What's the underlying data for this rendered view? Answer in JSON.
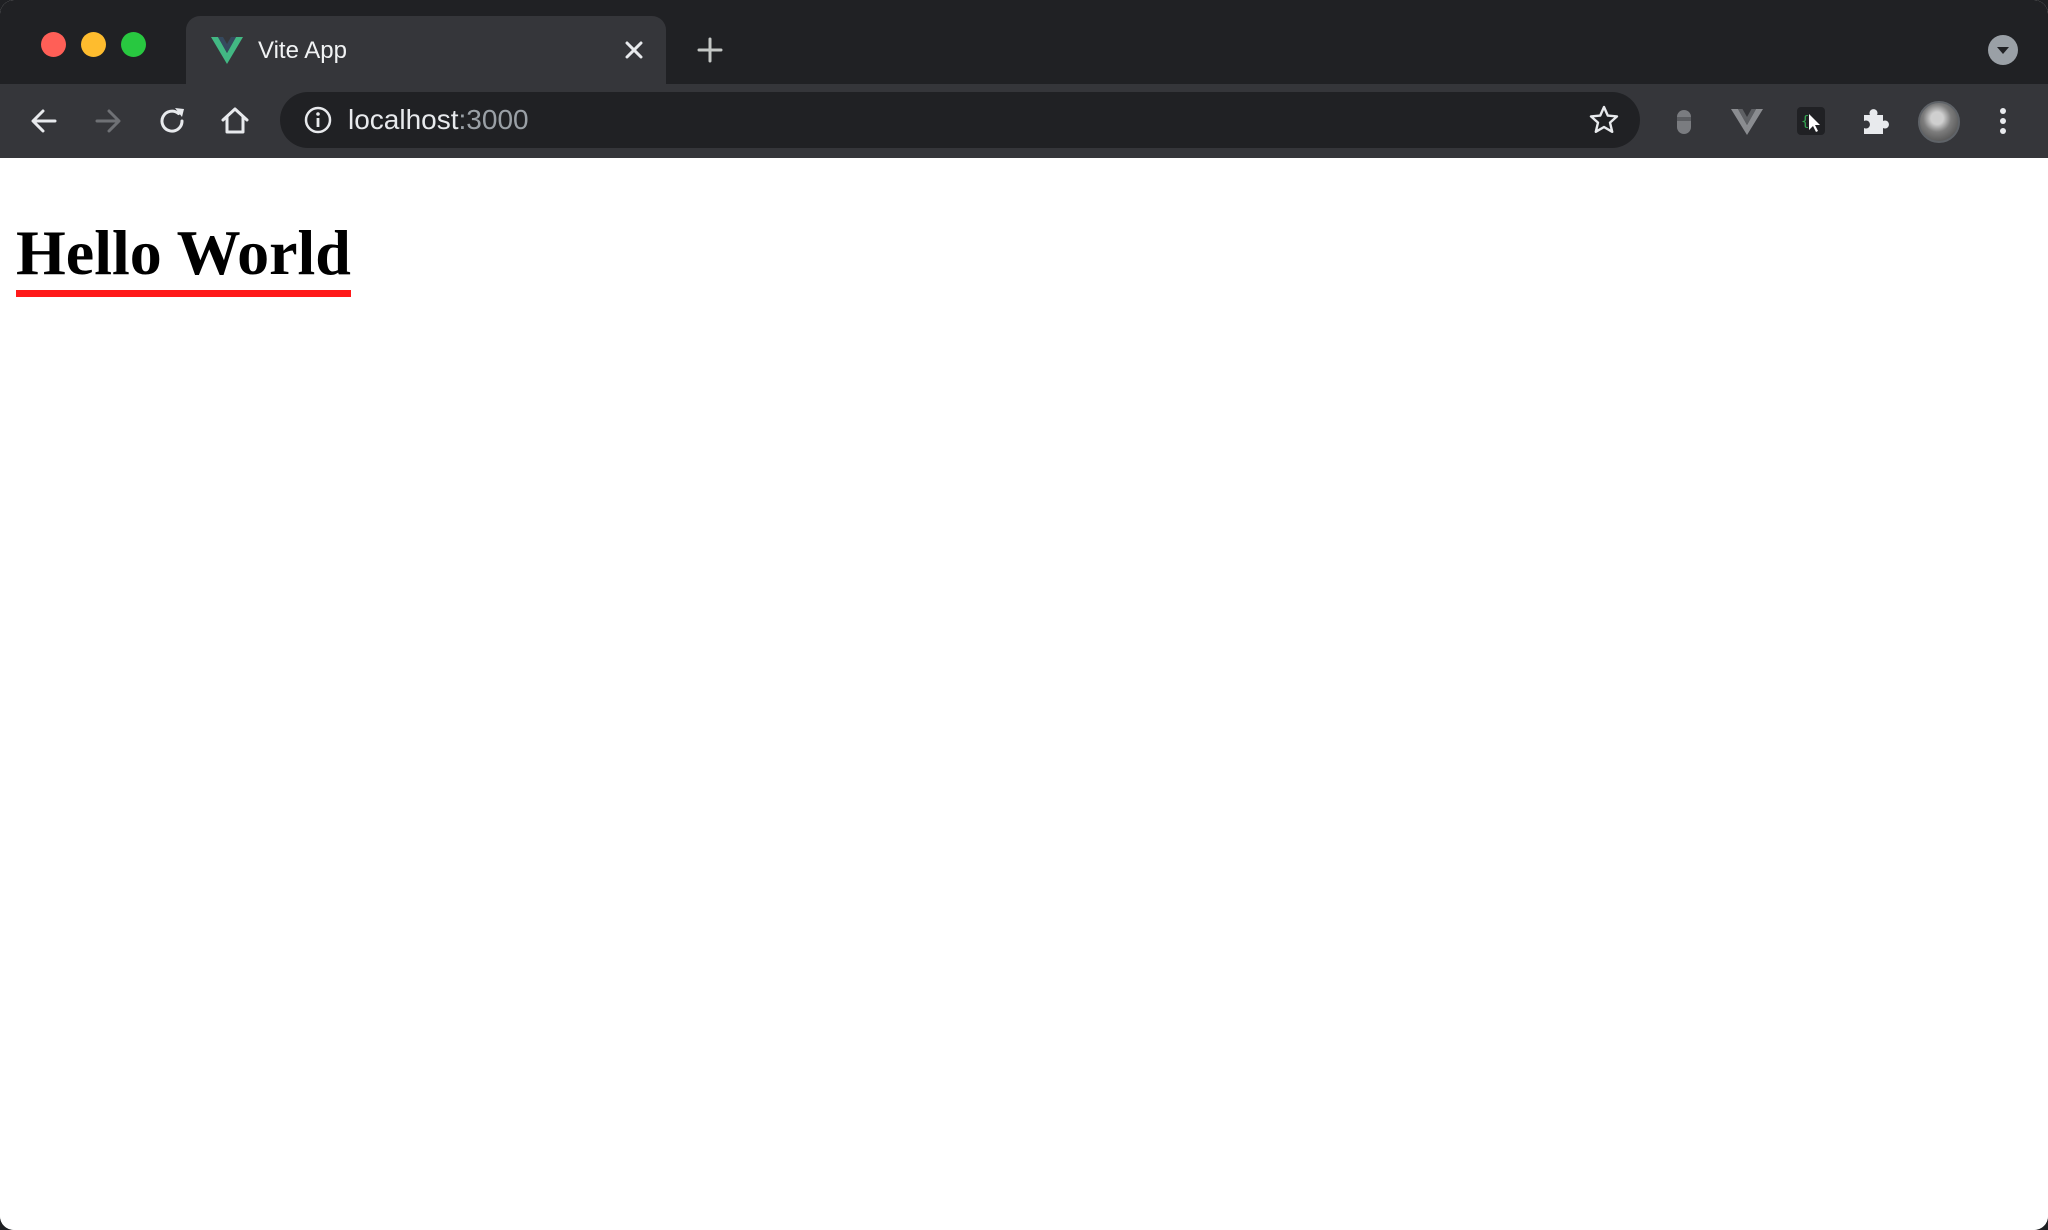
{
  "tab": {
    "title": "Vite App"
  },
  "address_bar": {
    "host": "localhost",
    "port": ":3000"
  },
  "page": {
    "heading": "Hello World"
  },
  "colors": {
    "tab_strip": "#202124",
    "toolbar": "#35363a",
    "heading_underline": "#ff1a1a",
    "vue_green": "#42b883"
  },
  "icons": {
    "window_controls": [
      "close",
      "minimize",
      "zoom"
    ],
    "toolbar": [
      "back-arrow-icon",
      "forward-arrow-icon",
      "reload-icon",
      "home-icon"
    ],
    "extensions": [
      "extension-grey-icon",
      "vue-devtools-icon",
      "cursor-extension-icon",
      "puzzle-icon"
    ]
  }
}
